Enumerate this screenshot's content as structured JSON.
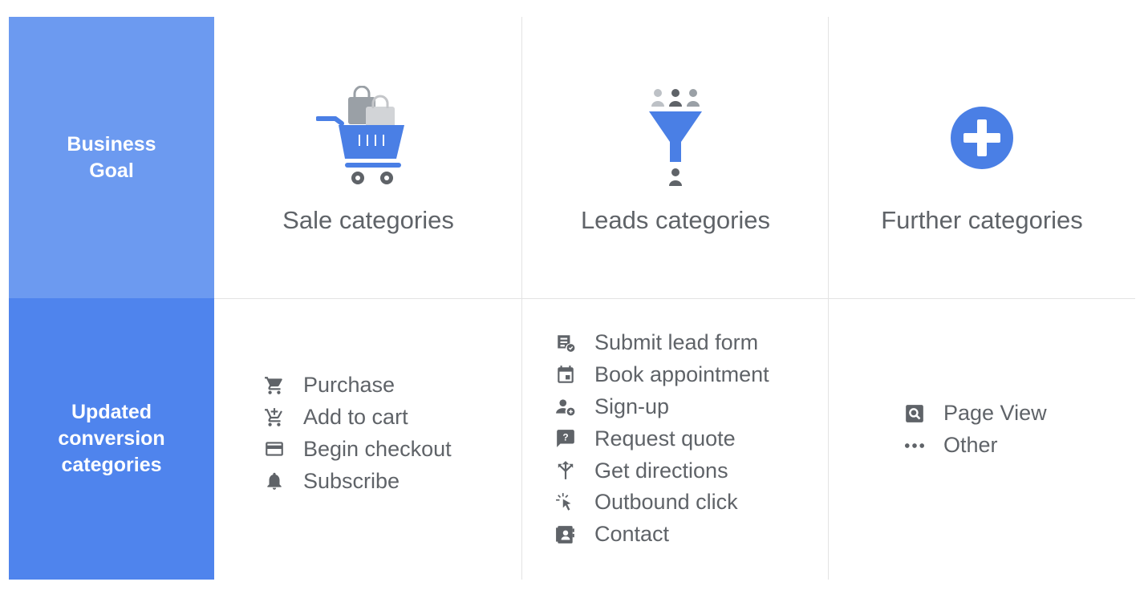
{
  "row_headers": {
    "business_goal": "Business\nGoal",
    "updated_categories": "Updated\nconversion\ncategories"
  },
  "goals": [
    {
      "title": "Sale categories",
      "icon": "shopping-cart-icon"
    },
    {
      "title": "Leads categories",
      "icon": "funnel-icon"
    },
    {
      "title": "Further categories",
      "icon": "plus-circle-icon"
    }
  ],
  "sale_items": [
    {
      "label": "Purchase",
      "icon": "cart-icon"
    },
    {
      "label": "Add to cart",
      "icon": "add-to-cart-icon"
    },
    {
      "label": "Begin checkout",
      "icon": "credit-card-icon"
    },
    {
      "label": "Subscribe",
      "icon": "bell-icon"
    }
  ],
  "lead_items": [
    {
      "label": "Submit lead form",
      "icon": "form-check-icon"
    },
    {
      "label": "Book appointment",
      "icon": "calendar-icon"
    },
    {
      "label": "Sign-up",
      "icon": "person-add-icon"
    },
    {
      "label": "Request quote",
      "icon": "question-bubble-icon"
    },
    {
      "label": "Get directions",
      "icon": "directions-icon"
    },
    {
      "label": "Outbound click",
      "icon": "pointer-click-icon"
    },
    {
      "label": "Contact",
      "icon": "contact-card-icon"
    }
  ],
  "further_items": [
    {
      "label": "Page View",
      "icon": "page-search-icon"
    },
    {
      "label": "Other",
      "icon": "more-dots-icon"
    }
  ],
  "colors": {
    "header_top": "#6c9af0",
    "header_bottom": "#4f84ed",
    "accent_blue": "#4a7fe5",
    "icon_gray": "#5f6368",
    "text_gray": "#5f6368",
    "grid": "#e3e3e3"
  }
}
